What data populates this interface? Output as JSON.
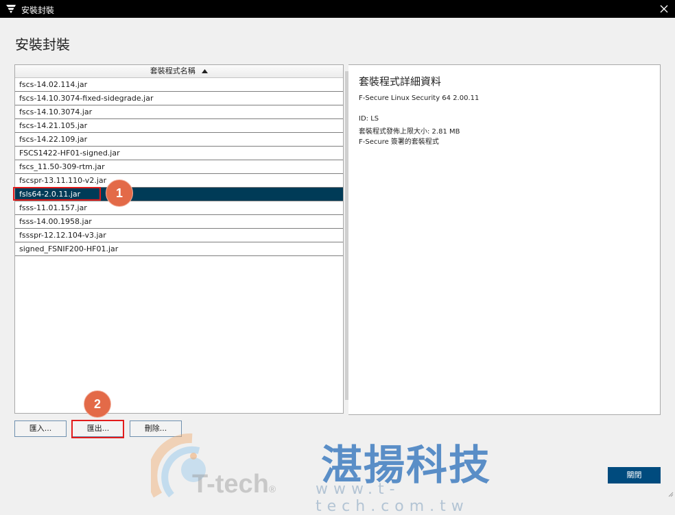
{
  "window": {
    "title": "安裝封裝",
    "app_icon": "f-secure-logo-icon",
    "close_icon": "close-icon"
  },
  "page": {
    "title": "安裝封裝"
  },
  "package_list": {
    "column_header": "套裝程式名稱",
    "sort_icon": "sort-ascending-icon",
    "rows": [
      "fscs-14.02.114.jar",
      "fscs-14.10.3074-fixed-sidegrade.jar",
      "fscs-14.10.3074.jar",
      "fscs-14.21.105.jar",
      "fscs-14.22.109.jar",
      "FSCS1422-HF01-signed.jar",
      "fscs_11.50-309-rtm.jar",
      "fscspr-13.11.110-v2.jar",
      "fsls64-2.0.11.jar",
      "fsss-11.01.157.jar",
      "fsss-14.00.1958.jar",
      "fssspr-12.12.104-v3.jar",
      "signed_FSNIF200-HF01.jar"
    ],
    "selected_index": 8
  },
  "details": {
    "title": "套裝程式詳細資料",
    "product": "F-Secure Linux Security 64 2.00.11",
    "id": "ID: LS",
    "size": "套裝程式發佈上限大小: 2.81 MB",
    "signed_by": "F-Secure 簽署的套裝程式"
  },
  "buttons": {
    "import": "匯入...",
    "export": "匯出...",
    "delete": "刪除...",
    "close": "關閉"
  },
  "annotations": {
    "step1": "1",
    "step2": "2"
  },
  "watermark": {
    "brand": "湛揚科技",
    "url": "www.t-tech.com.tw",
    "logo_text": "T-tech",
    "registered": "®"
  },
  "colors": {
    "selection": "#003b57",
    "primary_button": "#004b7e",
    "highlight": "#e31b1b",
    "badge": "#e36a48"
  }
}
